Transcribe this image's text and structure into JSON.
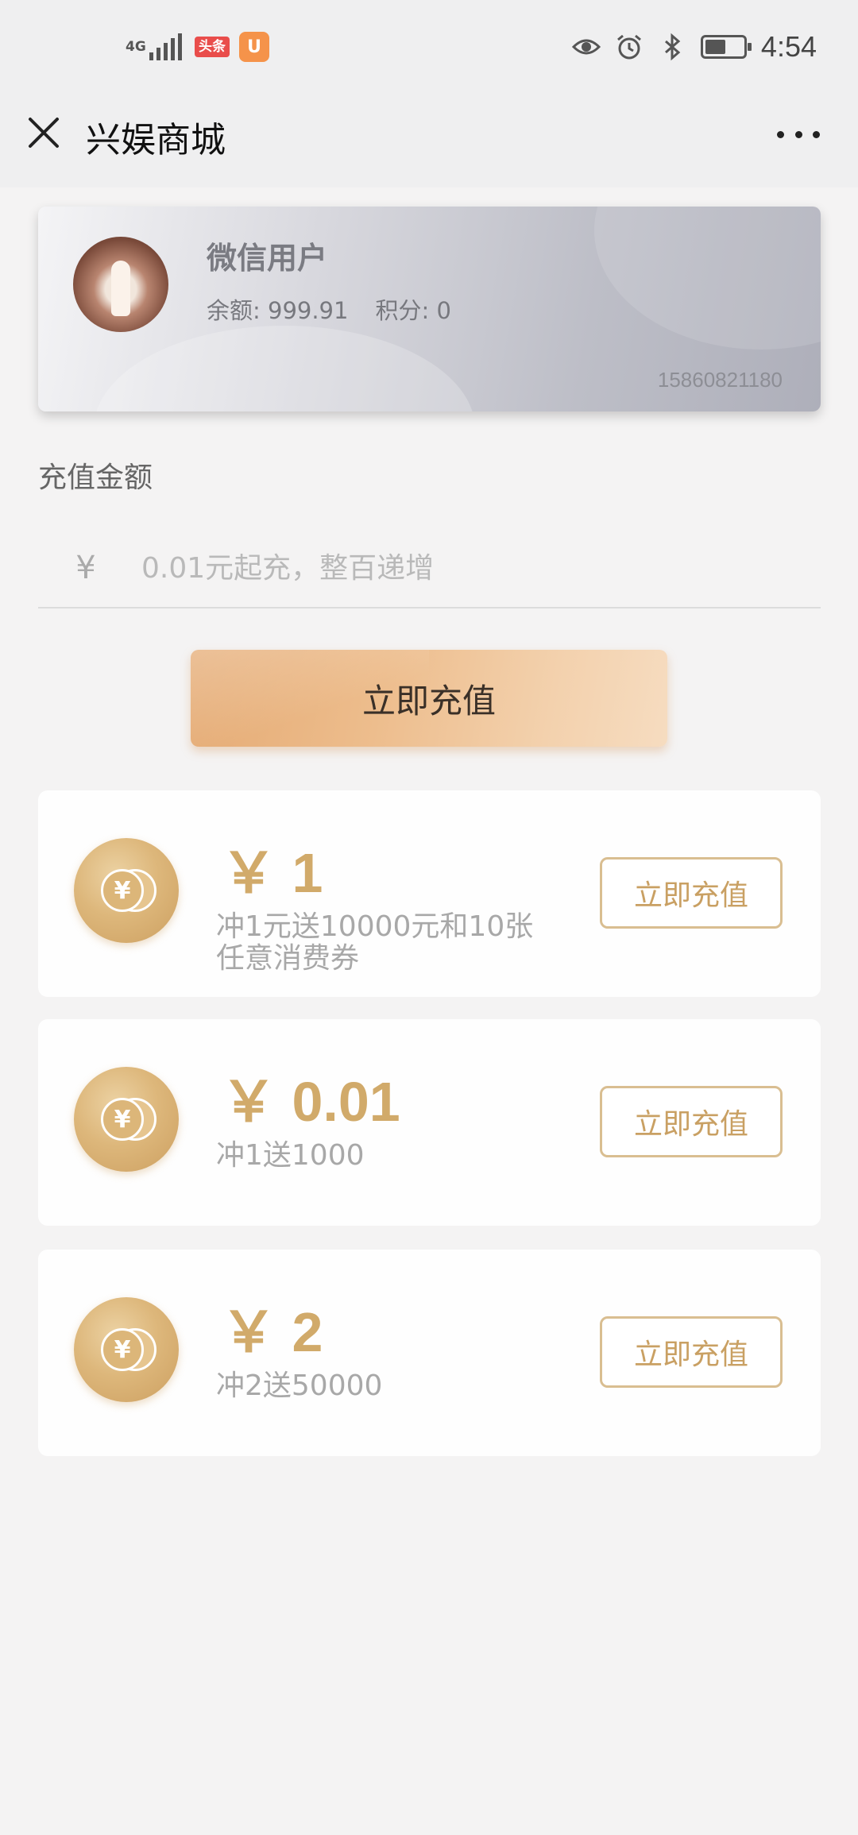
{
  "status_bar": {
    "network": "4G",
    "badge_news": "头条",
    "badge_app": "U",
    "time": "4:54",
    "battery_level": 0.55,
    "icons": [
      "eye-icon",
      "alarm-icon",
      "bluetooth-icon",
      "battery-icon"
    ]
  },
  "nav": {
    "title": "兴娱商城",
    "close_icon": "close-icon",
    "more_icon": "more-icon"
  },
  "member": {
    "name": "微信用户",
    "balance": "余额: 999.91",
    "points": "积分: 0",
    "phone": "15860821180"
  },
  "recharge": {
    "section_label": "充值金额",
    "currency": "¥",
    "placeholder": "0.01元起充，整百递增",
    "value": "",
    "submit_label": "立即充值"
  },
  "offers": [
    {
      "price": "￥ 1",
      "desc": "冲1元送10000元和10张任意消费券",
      "button": "立即充值"
    },
    {
      "price": "￥ 0.01",
      "desc": "冲1送1000",
      "button": "立即充值"
    },
    {
      "price": "￥ 2",
      "desc": "冲2送50000",
      "button": "立即充值"
    }
  ],
  "colors": {
    "gold": "#d1aa6a",
    "button_gradient_start": "#e5ab74",
    "button_gradient_end": "#f6dcc0"
  }
}
